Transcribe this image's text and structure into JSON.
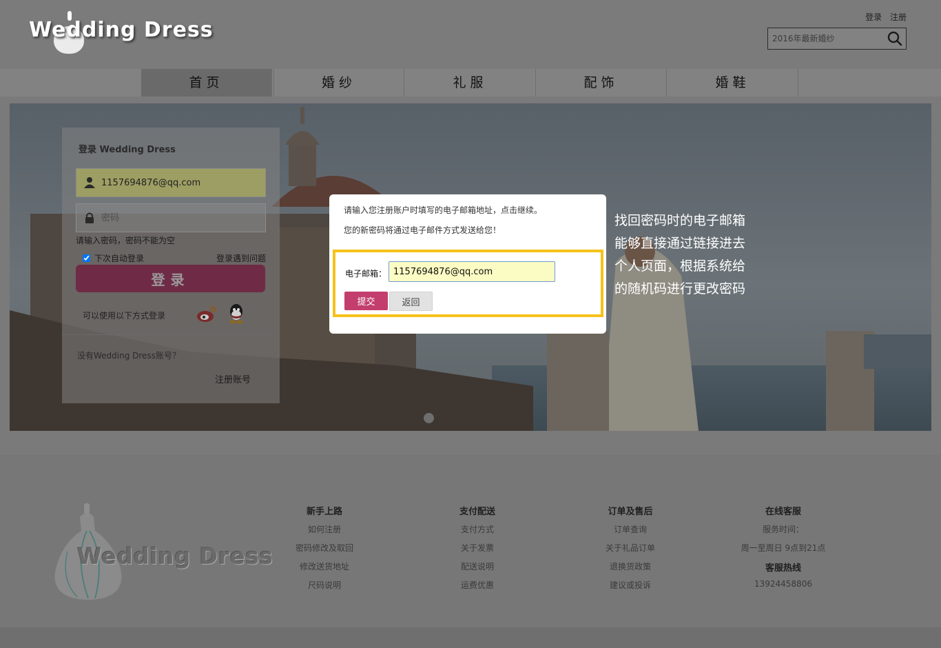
{
  "header": {
    "logo_text": "Wedding Dress",
    "login_link": "登录",
    "register_link": "注册",
    "search_placeholder": "2016年最新婚纱"
  },
  "nav": {
    "items": [
      {
        "label": "首页",
        "active": true
      },
      {
        "label": "婚纱",
        "active": false
      },
      {
        "label": "礼服",
        "active": false
      },
      {
        "label": "配饰",
        "active": false
      },
      {
        "label": "婚鞋",
        "active": false
      }
    ]
  },
  "login_panel": {
    "title": "登录 Wedding Dress",
    "username_value": "1157694876@qq.com",
    "password_placeholder": "密码",
    "validation_hint": "请输入密码，密码不能为空",
    "remember_label": "下次自动登录",
    "remember_checked": true,
    "problem_link": "登录遇到问题",
    "login_button": "登录",
    "alt_login_text": "可以使用以下方式登录",
    "no_account_text": "没有Wedding Dress账号？",
    "register_link": "注册账号"
  },
  "modal": {
    "line1": "请输入您注册账户时填写的电子邮箱地址，点击继续。",
    "line2": "您的新密码将通过电子邮件方式发送给您！",
    "email_label": "电子邮箱：",
    "email_value": "1157694876@qq.com",
    "submit_button": "提交",
    "back_button": "返回",
    "highlight_color": "#f6c21a",
    "submit_color": "#c33e6c"
  },
  "annotation": {
    "lines": [
      "找回密码时的电子邮箱",
      "能够直接通过链接进去",
      "个人页面，根据系统给",
      "的随机码进行更改密码"
    ]
  },
  "footer": {
    "logo_text": "Wedding Dress",
    "columns": [
      {
        "title": "新手上路",
        "links": [
          "如何注册",
          "密码修改及取回",
          "修改送货地址",
          "尺码说明"
        ]
      },
      {
        "title": "支付配送",
        "links": [
          "支付方式",
          "关于发票",
          "配送说明",
          "运费优惠"
        ]
      },
      {
        "title": "订单及售后",
        "links": [
          "订单查询",
          "关于礼品订单",
          "退换货政策",
          "建议或投诉"
        ]
      },
      {
        "title": "在线客服",
        "service_label": "服务时间：",
        "service_hours": "周一至周日 9点到21点",
        "hotline_title": "客服热线",
        "hotline": "13924458806"
      }
    ]
  }
}
